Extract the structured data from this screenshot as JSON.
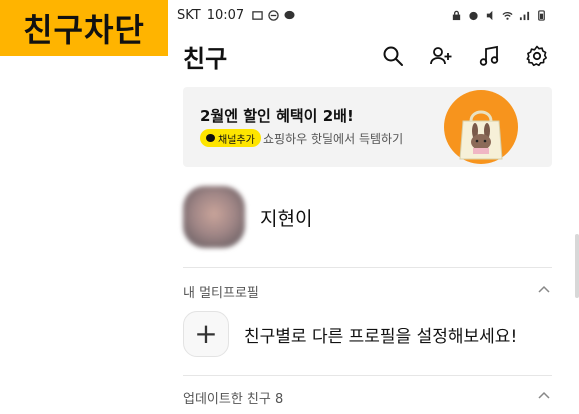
{
  "caption": {
    "text": "친구차단"
  },
  "status_bar": {
    "carrier": "SKT",
    "time": "10:07"
  },
  "header": {
    "title": "친구"
  },
  "banner": {
    "title": "2월엔 할인 혜택이 2배!",
    "badge": "채널추가",
    "subtitle": "쇼핑하우 핫딜에서 득템하기"
  },
  "my_profile": {
    "name": "지현이"
  },
  "multi_profile": {
    "section_label": "내 멀티프로필",
    "add_text": "친구별로 다른 프로필을 설정해보세요!"
  },
  "updated_friends": {
    "section_label": "업데이트한 친구 8"
  },
  "colors": {
    "caption_bg": "#ffb400",
    "badge_bg": "#fee500",
    "banner_bg": "#f3f3f3",
    "art_orange": "#f7941d"
  },
  "icons": [
    "search-icon",
    "add-friend-icon",
    "music-icon",
    "settings-icon",
    "chevron-up-icon",
    "plus-icon"
  ]
}
